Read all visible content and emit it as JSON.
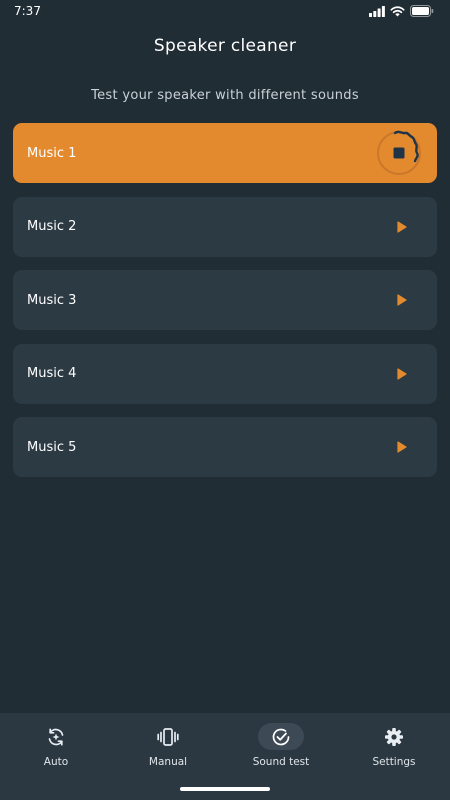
{
  "status_bar": {
    "time": "7:37"
  },
  "header": {
    "title": "Speaker cleaner",
    "subtitle": "Test your speaker with different sounds"
  },
  "tracks": [
    {
      "label": "Music 1",
      "state": "playing"
    },
    {
      "label": "Music 2",
      "state": "stopped"
    },
    {
      "label": "Music 3",
      "state": "stopped"
    },
    {
      "label": "Music 4",
      "state": "stopped"
    },
    {
      "label": "Music 5",
      "state": "stopped"
    }
  ],
  "bottom_nav": {
    "items": [
      {
        "label": "Auto",
        "icon": "auto-refresh-icon"
      },
      {
        "label": "Manual",
        "icon": "vibrate-phone-icon"
      },
      {
        "label": "Sound test",
        "icon": "check-circle-icon",
        "selected": true
      },
      {
        "label": "Settings",
        "icon": "gear-icon"
      }
    ]
  },
  "colors": {
    "background": "#212d35",
    "card": "#2c3a44",
    "accent": "#e38a2f",
    "nav_background": "#2b3741",
    "active_icon": "#1f3447"
  }
}
